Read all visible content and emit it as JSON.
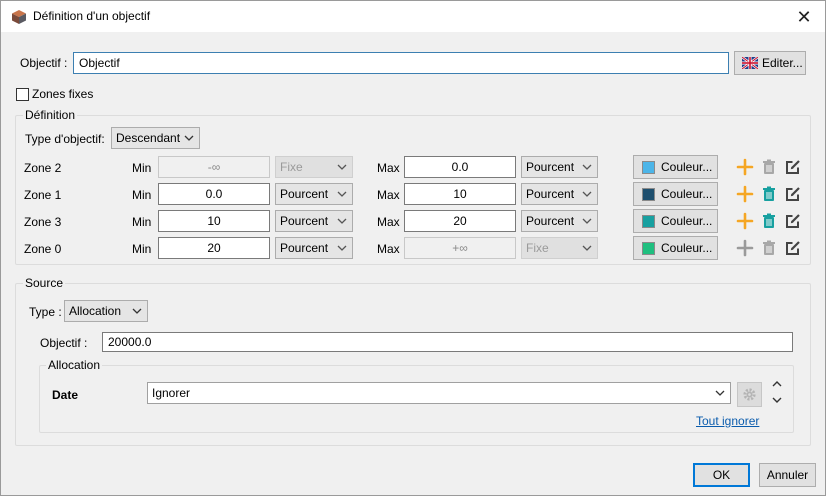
{
  "window": {
    "title": "Définition d'un objectif",
    "close_icon": "close-icon"
  },
  "objective": {
    "label": "Objectif :",
    "value": "Objectif",
    "edit_button": "Editer...",
    "edit_flag_icon": "uk-flag-icon"
  },
  "fixed_zones": {
    "label": "Zones fixes",
    "checked": false
  },
  "definition": {
    "group_title": "Définition",
    "type_label": "Type d'objectif:",
    "type_value": "Descendant",
    "min_label": "Min",
    "max_label": "Max",
    "color_button": "Couleur...",
    "zones": [
      {
        "name": "Zone 2",
        "min": "-∞",
        "min_unit": "Fixe",
        "max": "0.0",
        "max_unit": "Pourcent",
        "color": "#4cb5e8",
        "min_disabled": true,
        "max_disabled": false,
        "add_enabled": true,
        "delete_enabled": false
      },
      {
        "name": "Zone 1",
        "min": "0.0",
        "min_unit": "Pourcent",
        "max": "10",
        "max_unit": "Pourcent",
        "color": "#1e4f6e",
        "min_disabled": false,
        "max_disabled": false,
        "add_enabled": true,
        "delete_enabled": true
      },
      {
        "name": "Zone 3",
        "min": "10",
        "min_unit": "Pourcent",
        "max": "20",
        "max_unit": "Pourcent",
        "color": "#17a0a0",
        "min_disabled": false,
        "max_disabled": false,
        "add_enabled": true,
        "delete_enabled": true
      },
      {
        "name": "Zone 0",
        "min": "20",
        "min_unit": "Pourcent",
        "max": "+∞",
        "max_unit": "Fixe",
        "color": "#1fbf7f",
        "min_disabled": false,
        "max_disabled": true,
        "add_enabled": false,
        "delete_enabled": false
      }
    ]
  },
  "source": {
    "group_title": "Source",
    "type_label": "Type :",
    "type_value": "Allocation",
    "objective_label": "Objectif :",
    "objective_value": "20000.0",
    "allocation": {
      "group_title": "Allocation",
      "date_label": "Date",
      "date_value": "Ignorer",
      "ignore_all_link": "Tout ignorer"
    }
  },
  "footer": {
    "ok": "OK",
    "cancel": "Annuler"
  },
  "colors": {
    "accent": "#0078d7",
    "add_orange": "#f5a623",
    "delete_teal": "#17a0a0",
    "link": "#0b5cad"
  }
}
